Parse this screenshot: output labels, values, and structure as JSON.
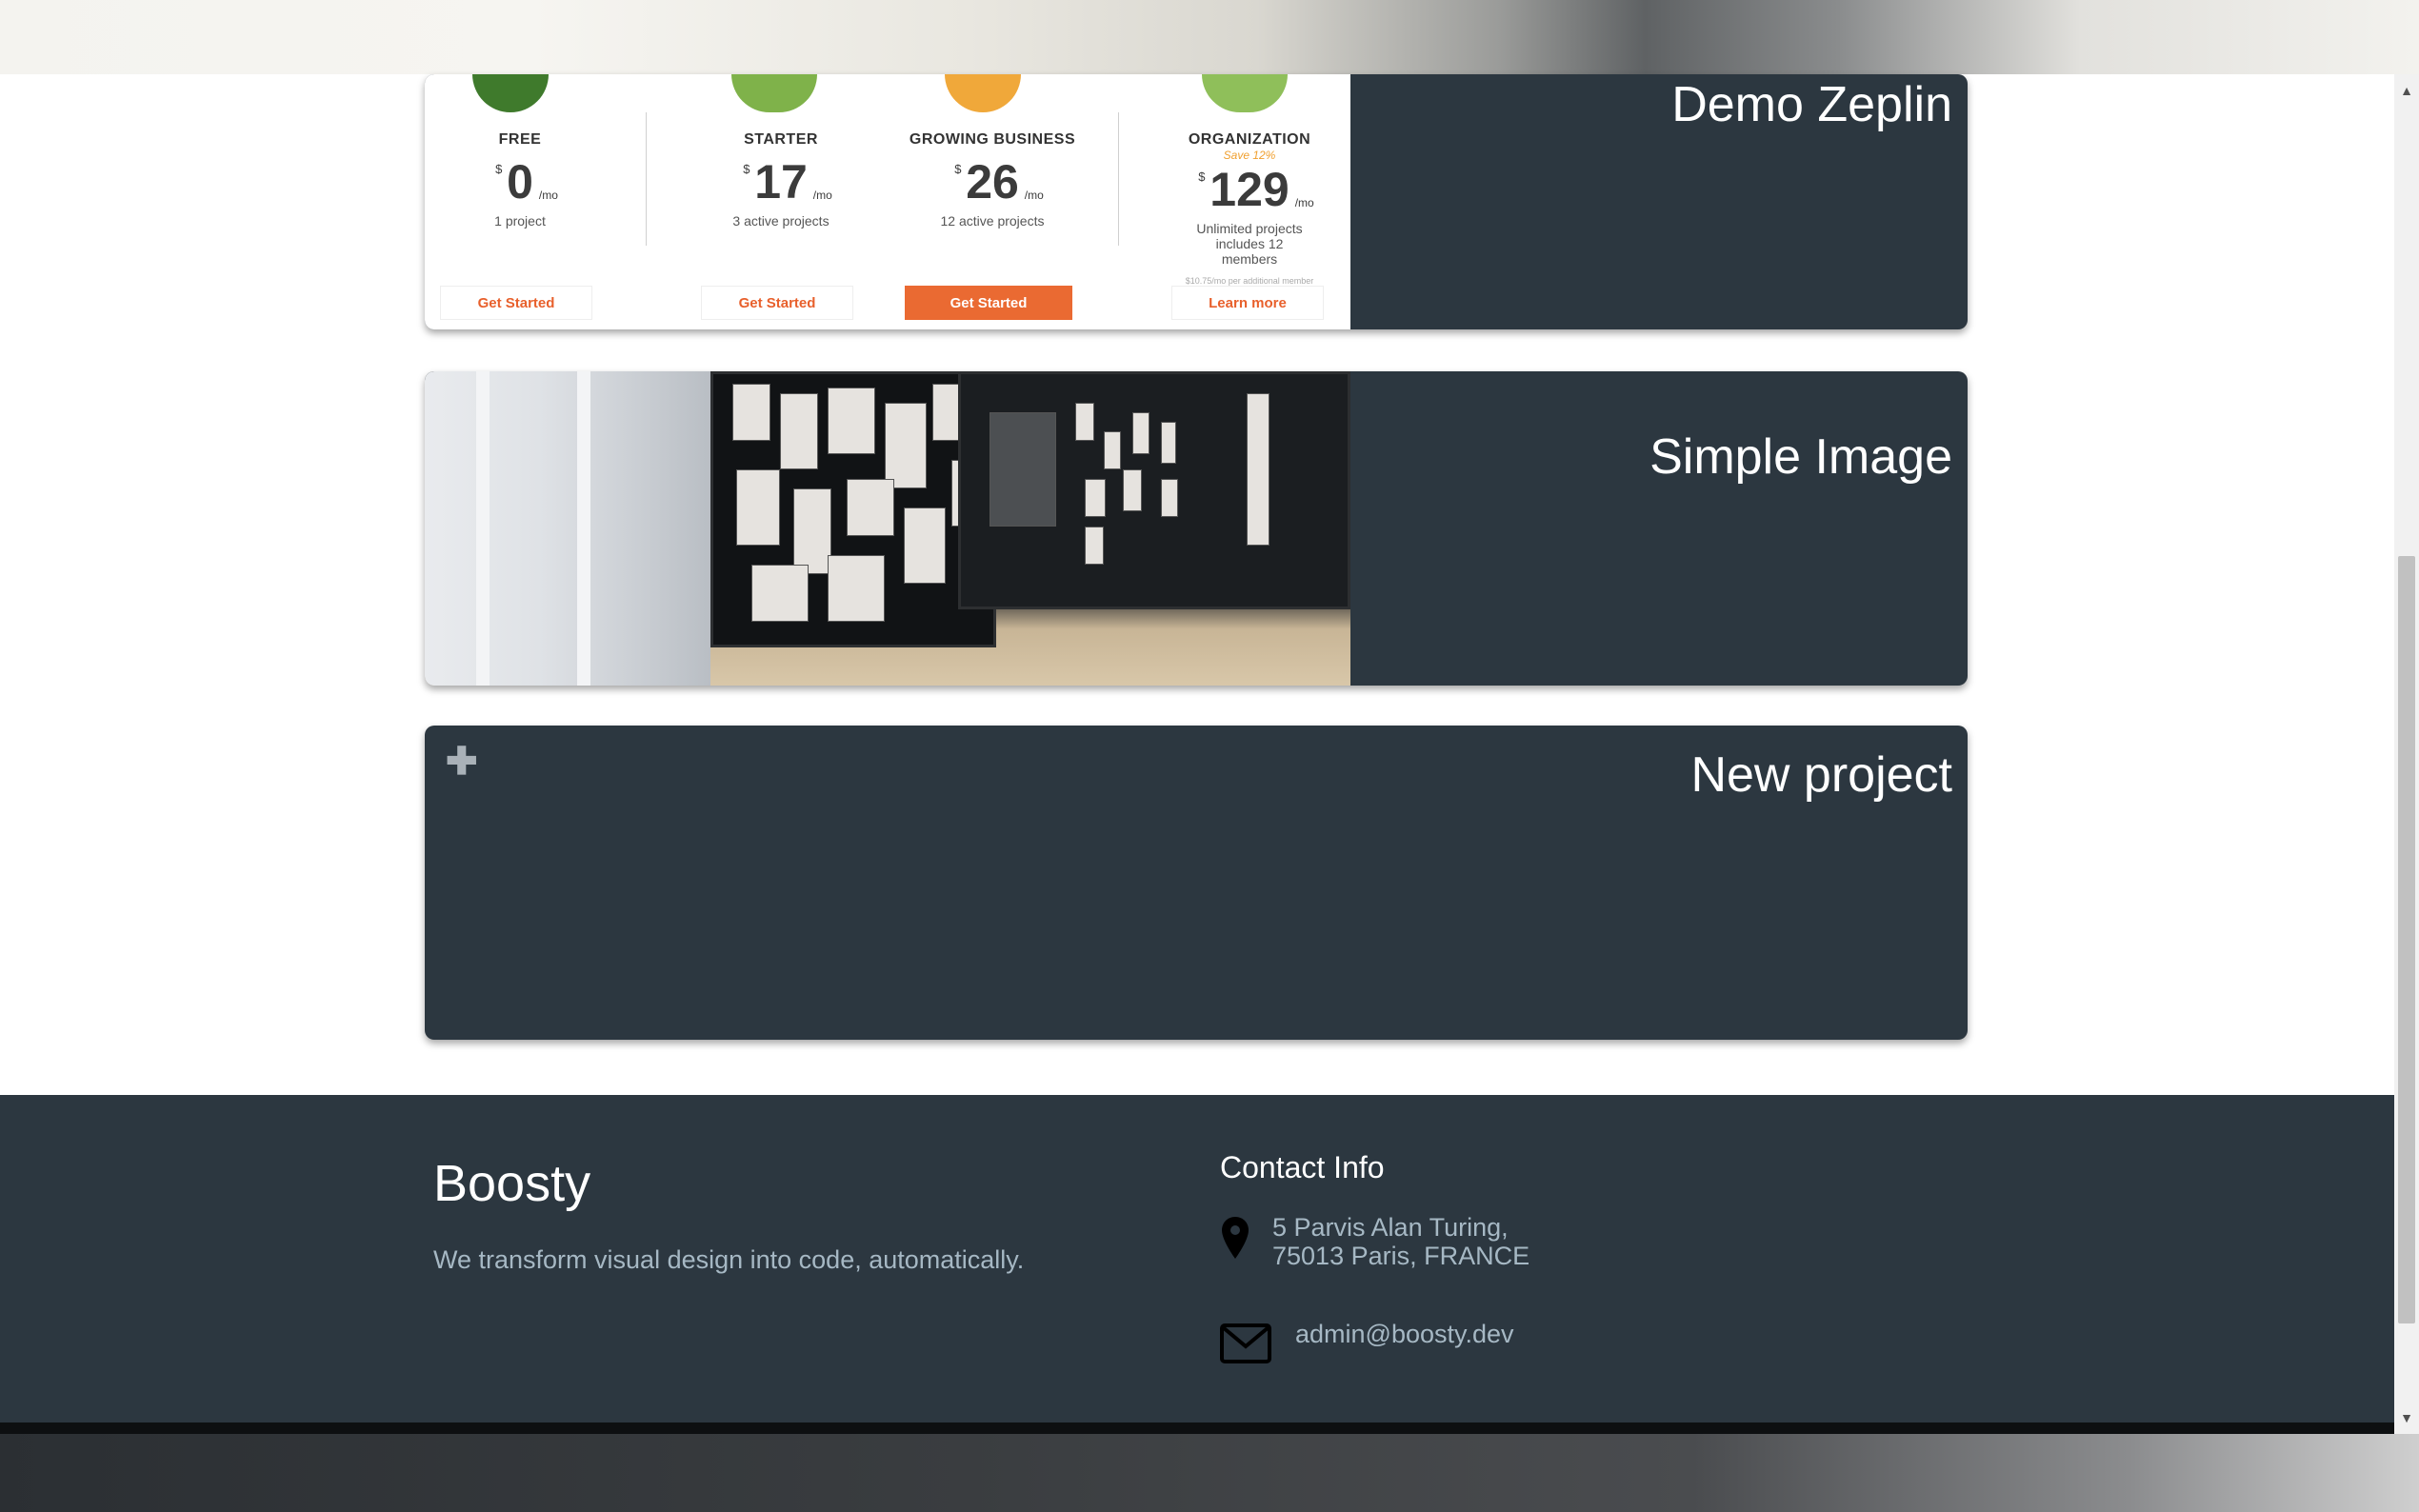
{
  "cards": [
    {
      "title": "Demo Zeplin"
    },
    {
      "title": "Simple Image"
    },
    {
      "title": "New project"
    }
  ],
  "pricing": {
    "plans": [
      {
        "name": "FREE",
        "currency": "$",
        "price": "0",
        "period": "/mo",
        "desc": "1 project",
        "button": "Get Started"
      },
      {
        "name": "STARTER",
        "currency": "$",
        "price": "17",
        "period": "/mo",
        "desc": "3 active projects",
        "button": "Get Started"
      },
      {
        "name": "GROWING BUSINESS",
        "currency": "$",
        "price": "26",
        "period": "/mo",
        "desc": "12 active projects",
        "button": "Get Started"
      },
      {
        "name": "ORGANIZATION",
        "currency": "$",
        "price": "129",
        "period": "/mo",
        "desc": "Unlimited projects includes 12 members",
        "save": "Save 12%",
        "extra": "$10.75/mo per additional member",
        "button": "Learn more"
      }
    ]
  },
  "new_project_icon": "plus-icon",
  "footer": {
    "brand": "Boosty",
    "tagline": "We transform visual design into code, automatically.",
    "contact_title": "Contact Info",
    "address_line1": "5 Parvis Alan Turing,",
    "address_line2": "75013 Paris, FRANCE",
    "email": "admin@boosty.dev"
  },
  "colors": {
    "card_bg": "#2c3740",
    "accent": "#ea6a32",
    "footer_text": "#a6b8c4"
  }
}
